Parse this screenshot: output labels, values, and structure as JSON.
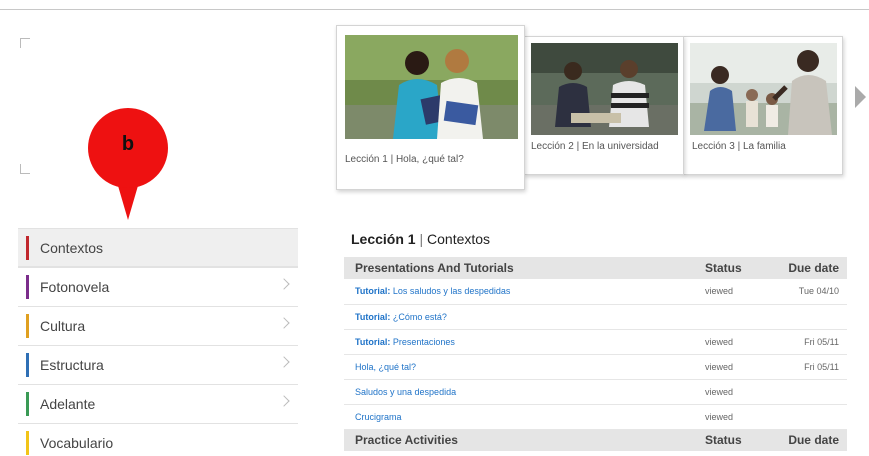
{
  "callout": {
    "label": "b"
  },
  "lessons": [
    {
      "caption": "Lección 1 | Hola, ¿qué tal?"
    },
    {
      "caption": "Lección 2 | En la universidad"
    },
    {
      "caption": "Lección 3 | La familia"
    }
  ],
  "sidebar": {
    "items": [
      {
        "label": "Contextos",
        "color": "#c0272d"
      },
      {
        "label": "Fotonovela",
        "color": "#7b2d8b"
      },
      {
        "label": "Cultura",
        "color": "#e0a020"
      },
      {
        "label": "Estructura",
        "color": "#2f6fb5"
      },
      {
        "label": "Adelante",
        "color": "#3a9a55"
      },
      {
        "label": "Vocabulario",
        "color": "#f2c418"
      }
    ]
  },
  "content": {
    "title_bold": "Lección 1",
    "title_sep": "|",
    "title_rest": "Contextos",
    "section1": {
      "title": "Presentations And Tutorials",
      "status": "Status",
      "due": "Due date"
    },
    "rows": [
      {
        "prefix": "Tutorial:",
        "title": " Los saludos y las despedidas",
        "status": "viewed",
        "due": "Tue 04/10"
      },
      {
        "prefix": "Tutorial:",
        "title": " ¿Cómo está?",
        "status": "",
        "due": ""
      },
      {
        "prefix": "Tutorial:",
        "title": " Presentaciones",
        "status": "viewed",
        "due": "Fri 05/11"
      },
      {
        "prefix": "",
        "title": "Hola, ¿qué tal?",
        "status": "viewed",
        "due": "Fri 05/11"
      },
      {
        "prefix": "",
        "title": "Saludos y una despedida",
        "status": "viewed",
        "due": ""
      },
      {
        "prefix": "",
        "title": "Crucigrama",
        "status": "viewed",
        "due": ""
      }
    ],
    "section2": {
      "title": "Practice Activities",
      "status": "Status",
      "due": "Due date"
    }
  },
  "colors": {
    "link": "#1f73c8",
    "callout": "#ee1111",
    "section_bg": "#e5e5e5"
  },
  "icons": {
    "next": "chevron-right-icon",
    "sidebar_chevron": "chevron-right-icon"
  }
}
